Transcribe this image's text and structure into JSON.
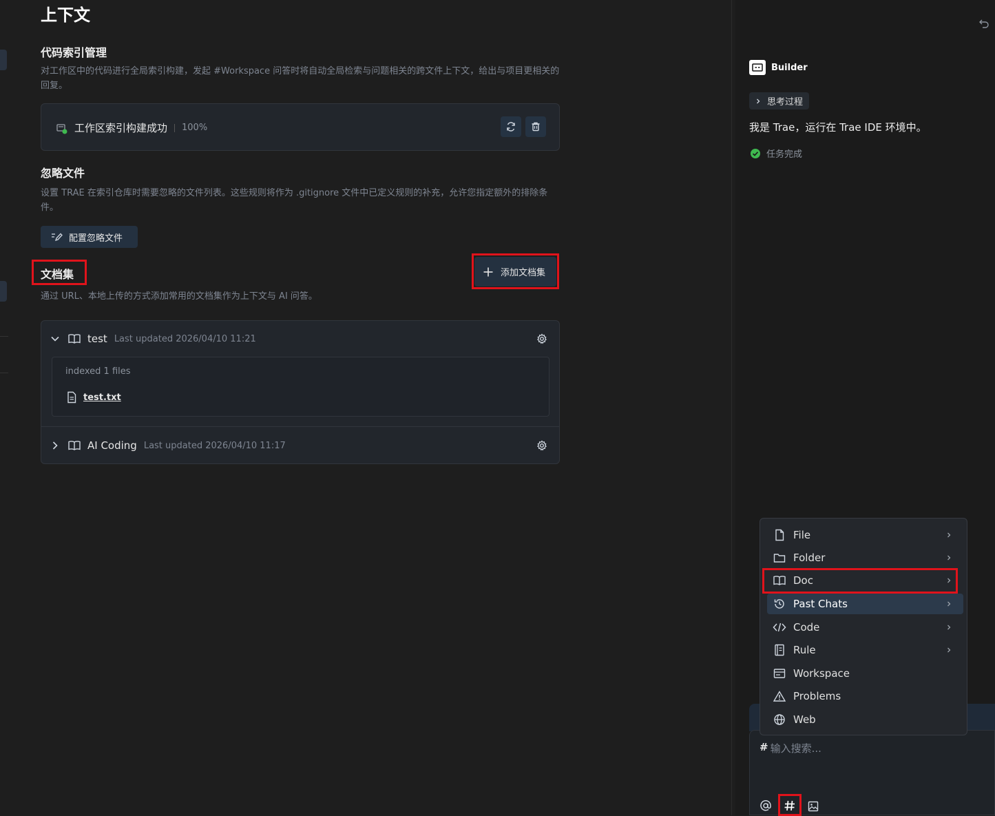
{
  "page_title": "上下文",
  "code_index": {
    "title": "代码索引管理",
    "description": "对工作区中的代码进行全局索引构建，发起 #Workspace 问答时将自动全局检索与问题相关的跨文件上下文，给出与项目更相关的回复。",
    "status_text": "工作区索引构建成功",
    "progress": "100%",
    "progress_value": 100
  },
  "ignore_files": {
    "title": "忽略文件",
    "description": "设置 TRAE 在索引仓库时需要忽略的文件列表。这些规则将作为 .gitignore 文件中已定义规则的补充，允许您指定额外的排除条件。",
    "button_label": "配置忽略文件"
  },
  "doc_sets": {
    "title": "文档集",
    "add_button_label": "添加文档集",
    "description": "通过 URL、本地上传的方式添加常用的文档集作为上下文与 AI 问答。",
    "items": [
      {
        "name": "test",
        "meta": "Last updated 2026/04/10 11:21",
        "expanded": true,
        "indexed_text": "indexed 1 files",
        "file": "test.txt"
      },
      {
        "name": "AI Coding",
        "meta": "Last updated 2026/04/10 11:17",
        "expanded": false
      }
    ]
  },
  "chat": {
    "agent_name": "Builder",
    "thinking_label": "思考过程",
    "message": "我是 Trae，运行在 Trae IDE 环境中。",
    "status": "任务完成"
  },
  "context_menu": {
    "items": [
      {
        "label": "File",
        "icon": "file-icon",
        "has_submenu": true
      },
      {
        "label": "Folder",
        "icon": "folder-icon",
        "has_submenu": true
      },
      {
        "label": "Doc",
        "icon": "book-icon",
        "has_submenu": true
      },
      {
        "label": "Past Chats",
        "icon": "history-icon",
        "has_submenu": true
      },
      {
        "label": "Code",
        "icon": "code-icon",
        "has_submenu": true
      },
      {
        "label": "Rule",
        "icon": "rule-icon",
        "has_submenu": true
      },
      {
        "label": "Workspace",
        "icon": "workspace-icon",
        "has_submenu": false
      },
      {
        "label": "Problems",
        "icon": "warning-icon",
        "has_submenu": false
      },
      {
        "label": "Web",
        "icon": "globe-icon",
        "has_submenu": false
      }
    ]
  },
  "input": {
    "prefix": "#",
    "placeholder": "输入搜索..."
  },
  "colors": {
    "accent_red": "#e0131b",
    "success_green": "#3fb950",
    "background": "#1e1e1e"
  }
}
